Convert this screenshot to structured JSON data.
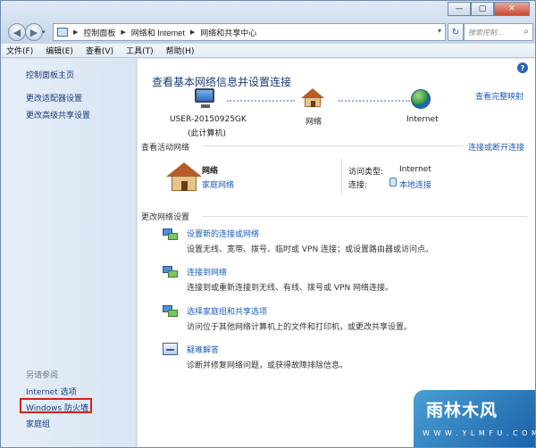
{
  "window": {
    "caption_minimize": "—",
    "caption_maximize": "▢",
    "caption_close": "✕"
  },
  "nav": {
    "back_glyph": "◀",
    "forward_glyph": "▶",
    "dropdown_glyph": "▾"
  },
  "address": {
    "crumbs": [
      "控制面板",
      "网络和 Internet",
      "网络和共享中心"
    ],
    "separator": "▶",
    "refresh_glyph": "↻"
  },
  "search": {
    "placeholder": "搜索控制..."
  },
  "menu": [
    "文件(F)",
    "编辑(E)",
    "查看(V)",
    "工具(T)",
    "帮助(H)"
  ],
  "sidebar": {
    "home": "控制面板主页",
    "adapter_settings": "更改适配器设置",
    "advanced_sharing": "更改高级共享设置",
    "see_also": "另请参阅",
    "internet_options": "Internet 选项",
    "windows_firewall": "Windows 防火墙",
    "homegroup": "家庭组"
  },
  "main": {
    "help_glyph": "?",
    "title": "查看基本网络信息并设置连接",
    "full_map": "查看完整映射",
    "computer_name": "USER-20150925GK",
    "this_computer": "(此计算机)",
    "network_node": "网络",
    "internet_node": "Internet",
    "active_networks_title": "查看活动网络",
    "connect_disconnect": "连接或断开连接",
    "network_name": "网络",
    "network_type": "家庭网络",
    "access_type_label": "访问类型:",
    "access_type_value": "Internet",
    "connection_label": "连接:",
    "connection_value": "本地连接",
    "change_settings_title": "更改网络设置",
    "tasks": [
      {
        "title": "设置新的连接或网络",
        "desc": "设置无线、宽带、拨号、临时或 VPN 连接；或设置路由器或访问点。"
      },
      {
        "title": "连接到网络",
        "desc": "连接到或重新连接到无线、有线、拨号或 VPN 网络连接。"
      },
      {
        "title": "选择家庭组和共享选项",
        "desc": "访问位于其他网络计算机上的文件和打印机，或更改共享设置。"
      },
      {
        "title": "疑难解答",
        "desc": "诊断并修复网络问题，或获得故障排除信息。"
      }
    ]
  },
  "watermark": {
    "big": "雨林木风",
    "small": "W W W . Y L M F U . C O M"
  }
}
